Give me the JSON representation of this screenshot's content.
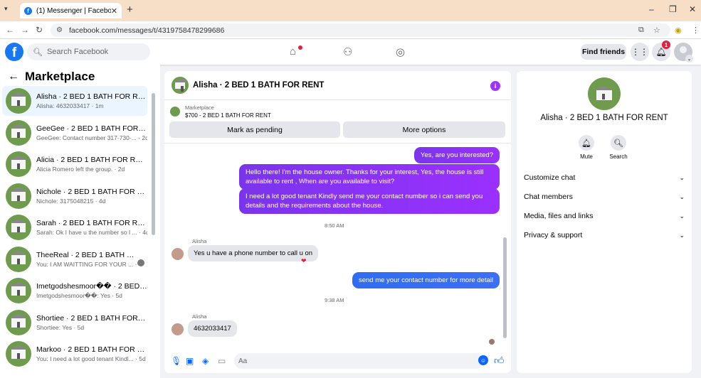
{
  "browser": {
    "tab_title": "(1) Messenger | Facebook",
    "tab_close": "✕",
    "new_tab": "+",
    "url": "facebook.com/messages/t/4319758478299686",
    "win_min": "–",
    "win_max": "❐",
    "win_close": "✕"
  },
  "header": {
    "search_placeholder": "Search Facebook",
    "find_friends_label": "Find friends",
    "notification_count": "1"
  },
  "sidebar": {
    "title": "Marketplace",
    "conversations": [
      {
        "name": "Alisha · 2 BED 1 BATH FOR RENT",
        "preview": "Alisha: 4632033417 · 1m",
        "active": true
      },
      {
        "name": "GeeGee · 2 BED 1 BATH FOR RENT",
        "preview": "GeeGee: Contact number 317-730-... · 2d"
      },
      {
        "name": "Alicia · 2 BED 1 BATH FOR RENT",
        "preview": "Alicia Romero left the group. · 2d"
      },
      {
        "name": "Nichole · 2 BED 1 BATH FOR RENT",
        "preview": "Nichole: 3175048215 · 4d"
      },
      {
        "name": "Sarah · 2 BED 1 BATH FOR RENT",
        "preview": "Sarah: Ok I have u the number so I ... · 4d"
      },
      {
        "name": "TheeReal · 2 BED 1 BATH FOR ...",
        "preview": "You: I AM WAITTING FOR YOUR ... · 4d"
      },
      {
        "name": "Imetgodshesmoor�� · 2 BED 1 ...",
        "preview": "Imetgodshesmoor��: Yes · 5d"
      },
      {
        "name": "Shortiee · 2 BED 1 BATH FOR RE...",
        "preview": "Shortiee: Yes · 5d"
      },
      {
        "name": "Markoo · 2 BED 1 BATH FOR RENT",
        "preview": "You: I need a lot good tenant Kindl... · 5d"
      }
    ]
  },
  "chat": {
    "title": "Alisha · 2 BED 1 BATH FOR RENT",
    "marketplace_label": "Marketplace",
    "listing": "$700 - 2 BED 1 BATH FOR RENT",
    "mark_pending_label": "Mark as pending",
    "more_options_label": "More options",
    "messages": {
      "m1": "Yes, are you interested?",
      "m2": "Hello there! I'm the house owner. Thanks for your interest, Yes, the house is still available to rent , When are you available to visit?",
      "m3": "I need a lot good tenant Kindly send me your contact number so i can send you details and the requirements about the house.",
      "time1": "8:50 AM",
      "sender1": "Alisha",
      "m4": "Yes u have a phone number to call u on",
      "m5": "send me your contact number for more detail",
      "time2": "9:38 AM",
      "sender2": "Alisha",
      "m6": "4632033417"
    },
    "compose_placeholder": "Aa"
  },
  "right_panel": {
    "name": "Alisha · 2 BED 1 BATH FOR RENT",
    "mute_label": "Mute",
    "search_label": "Search",
    "sections": [
      "Customize chat",
      "Chat members",
      "Media, files and links",
      "Privacy & support"
    ]
  }
}
